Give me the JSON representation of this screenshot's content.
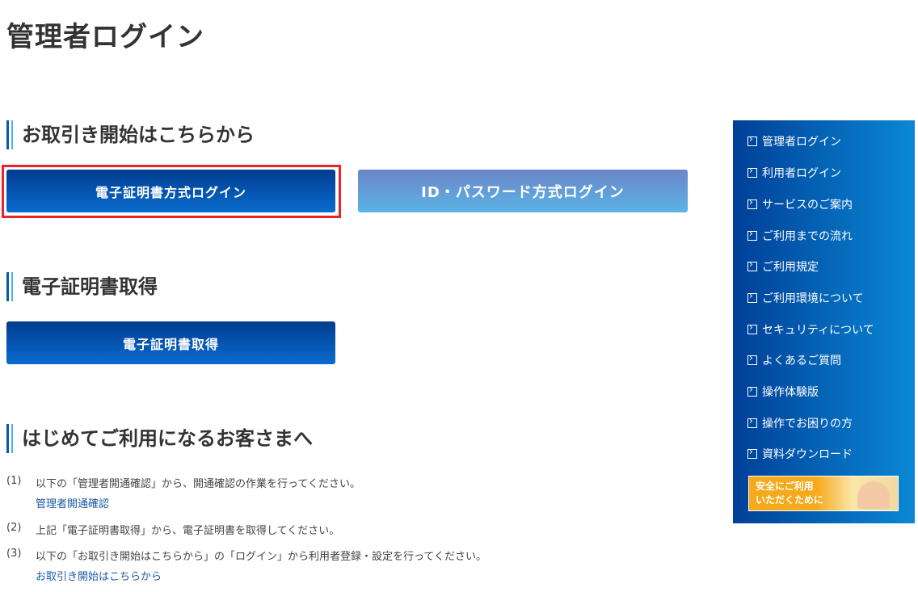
{
  "page_title": "管理者ログイン",
  "sections": {
    "start": {
      "heading": "お取引き開始はこちらから",
      "cert_login_label": "電子証明書方式ログイン",
      "id_login_label": "ID・パスワード方式ログイン"
    },
    "cert_get": {
      "heading": "電子証明書取得",
      "button_label": "電子証明書取得"
    },
    "first_time": {
      "heading": "はじめてご利用になるお客さまへ",
      "steps": [
        {
          "num": "(1)",
          "text": "以下の「管理者開通確認」から、開通確認の作業を行ってください。",
          "link": "管理者開通確認"
        },
        {
          "num": "(2)",
          "text": "上記「電子証明書取得」から、電子証明書を取得してください。"
        },
        {
          "num": "(3)",
          "text": "以下の「お取引き開始はこちらから」の「ログイン」から利用者登録・設定を行ってください。",
          "link": "お取引き開始はこちらから"
        }
      ]
    }
  },
  "sidebar": {
    "items": [
      {
        "label": "管理者ログイン"
      },
      {
        "label": "利用者ログイン"
      },
      {
        "label": "サービスのご案内"
      },
      {
        "label": "ご利用までの流れ"
      },
      {
        "label": "ご利用規定"
      },
      {
        "label": "ご利用環境について"
      },
      {
        "label": "セキュリティについて"
      },
      {
        "label": "よくあるご質問"
      },
      {
        "label": "操作体験版"
      },
      {
        "label": "操作でお困りの方"
      },
      {
        "label": "資料ダウンロード"
      }
    ],
    "banner_line1": "安全にご利用",
    "banner_line2": "いただくために"
  },
  "colors": {
    "accent": "#0a5aa8",
    "highlight": "#e8232a"
  }
}
